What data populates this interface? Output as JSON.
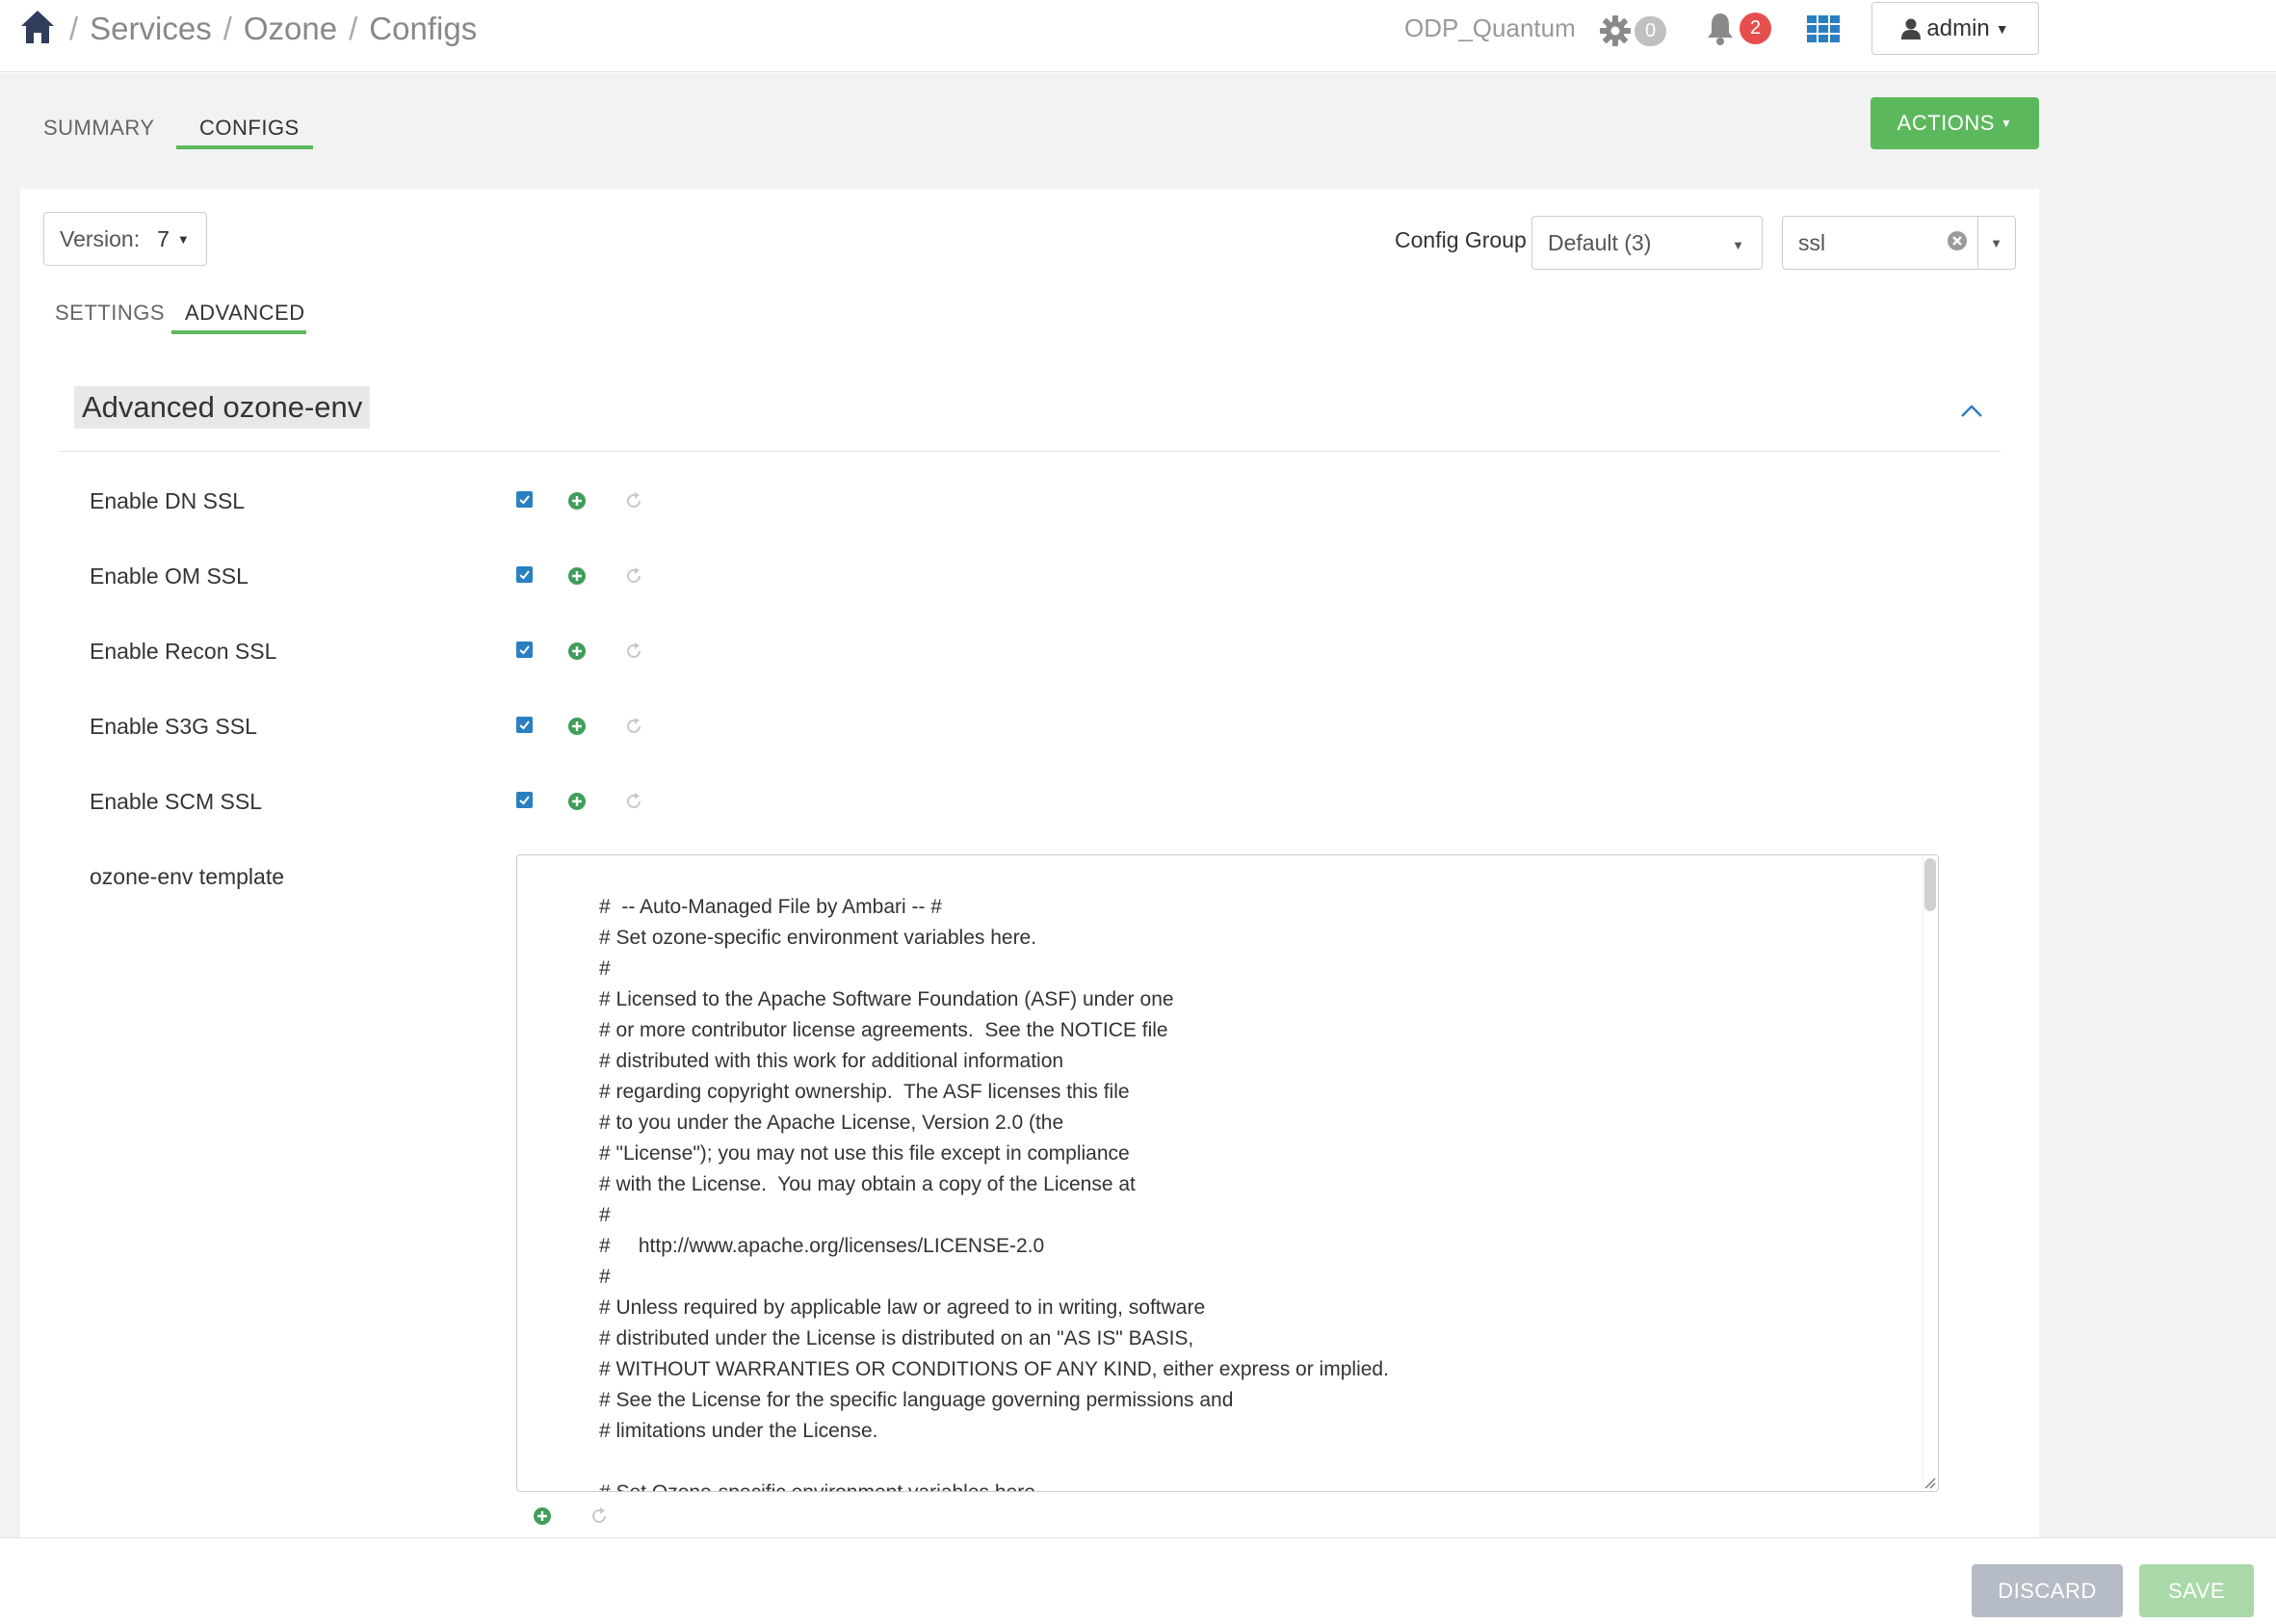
{
  "nav": {
    "breadcrumb": [
      "Services",
      "Ozone",
      "Configs"
    ],
    "separator": "/",
    "cluster_name": "ODP_Quantum",
    "ops_count": "0",
    "alerts_count": "2",
    "user_label": "admin"
  },
  "service_tabs": {
    "summary": "SUMMARY",
    "configs": "CONFIGS",
    "actions_label": "ACTIONS"
  },
  "config_toolbar": {
    "version_label": "Version:",
    "version_value": "7",
    "config_group_label": "Config Group",
    "config_group_value": "Default (3)",
    "filter_value": "ssl"
  },
  "config_tabs": {
    "settings": "SETTINGS",
    "advanced": "ADVANCED"
  },
  "section": {
    "title": "Advanced ozone-env",
    "properties": [
      {
        "label": "Enable DN SSL",
        "checked": true
      },
      {
        "label": "Enable OM SSL",
        "checked": true
      },
      {
        "label": "Enable Recon SSL",
        "checked": true
      },
      {
        "label": "Enable S3G SSL",
        "checked": true
      },
      {
        "label": "Enable SCM SSL",
        "checked": true
      }
    ],
    "template_label": "ozone-env template",
    "template_text": "#  -- Auto-Managed File by Ambari -- #\n# Set ozone-specific environment variables here.\n#\n# Licensed to the Apache Software Foundation (ASF) under one\n# or more contributor license agreements.  See the NOTICE file\n# distributed with this work for additional information\n# regarding copyright ownership.  The ASF licenses this file\n# to you under the Apache License, Version 2.0 (the\n# \"License\"); you may not use this file except in compliance\n# with the License.  You may obtain a copy of the License at\n#\n#     http://www.apache.org/licenses/LICENSE-2.0\n#\n# Unless required by applicable law or agreed to in writing, software\n# distributed under the License is distributed on an \"AS IS\" BASIS,\n# WITHOUT WARRANTIES OR CONDITIONS OF ANY KIND, either express or implied.\n# See the License for the specific language governing permissions and\n# limitations under the License.\n\n# Set Ozone-specific environment variables here."
  },
  "footer": {
    "discard_label": "DISCARD",
    "save_label": "SAVE"
  },
  "colors": {
    "accent_green": "#5cb85c",
    "alert_red": "#e64e4e",
    "checkbox_blue": "#2a7fc0",
    "home_blue": "#2f3d5a"
  }
}
